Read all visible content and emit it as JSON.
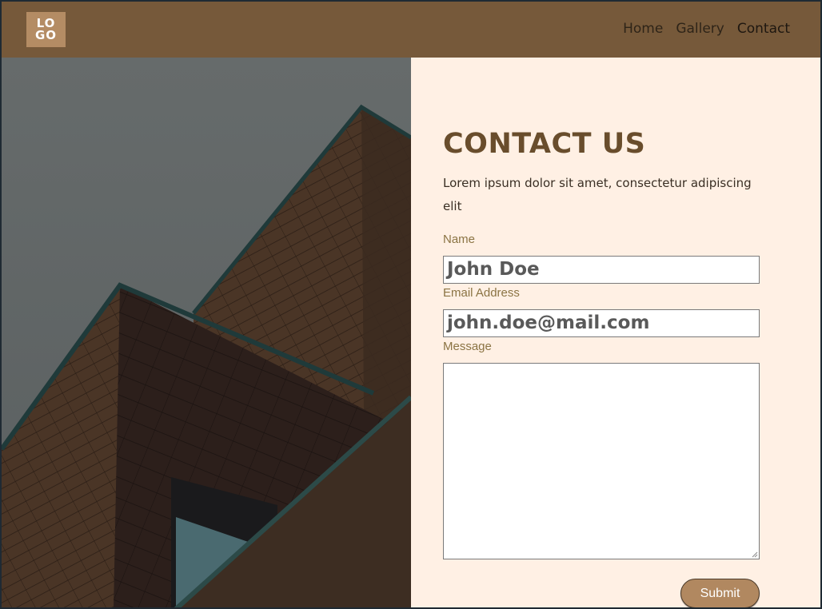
{
  "header": {
    "logo": {
      "line1": "LO",
      "line2": "GO"
    },
    "nav": [
      {
        "label": "Home"
      },
      {
        "label": "Gallery"
      },
      {
        "label": "Contact"
      }
    ]
  },
  "contact": {
    "title": "CONTACT US",
    "intro": "Lorem ipsum dolor sit amet, consectetur adipiscing elit",
    "fields": {
      "name": {
        "label": "Name",
        "value": "John Doe"
      },
      "email": {
        "label": "Email Address",
        "value": "john.doe@mail.com"
      },
      "message": {
        "label": "Message",
        "value": ""
      }
    },
    "submit_label": "Submit"
  },
  "colors": {
    "header_bg": "#76593a",
    "logo_bg": "#b48c64",
    "panel_bg": "#fff0e4",
    "title": "#694d2c",
    "label": "#8b7444",
    "button_bg": "#b18860"
  }
}
